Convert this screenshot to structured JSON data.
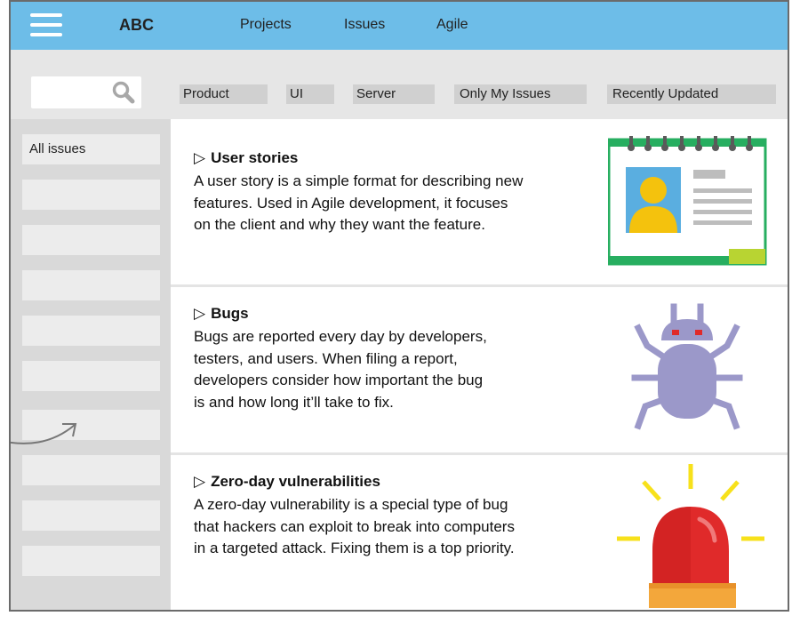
{
  "header": {
    "logo": "ABC",
    "nav": [
      "Projects",
      "Issues",
      "Agile"
    ]
  },
  "filters": {
    "search_placeholder": "",
    "chips": [
      "Product",
      "UI",
      "Server",
      "Only My Issues",
      "Recently Updated"
    ]
  },
  "sidebar": {
    "items": [
      "All issues",
      "",
      "",
      "",
      "",
      "",
      "",
      "",
      "",
      ""
    ]
  },
  "sections": [
    {
      "title": "User stories",
      "lines": [
        "A user story is a simple format for describing new",
        "features. Used in Agile development, it focuses",
        "on the client and why they want the feature."
      ],
      "icon": "profile-card-icon"
    },
    {
      "title": "Bugs",
      "lines": [
        "Bugs are reported every day by developers,",
        "testers, and users. When filing a report,",
        "developers consider how important the bug",
        "is and how long it’ll take to fix."
      ],
      "icon": "bug-icon"
    },
    {
      "title": "Zero-day vulnerabilities",
      "lines": [
        "A zero-day vulnerability is a special type of bug",
        "that hackers can exploit to break into computers",
        "in a targeted attack. Fixing them is a top priority."
      ],
      "icon": "alarm-siren-icon"
    }
  ],
  "colors": {
    "topbar": "#6dbde8",
    "filterbar": "#e6e6e6",
    "sidebar": "#d9d9d9",
    "bug": "#9b98c9",
    "siren": "#e02a2a",
    "card_border": "#27ae60"
  }
}
